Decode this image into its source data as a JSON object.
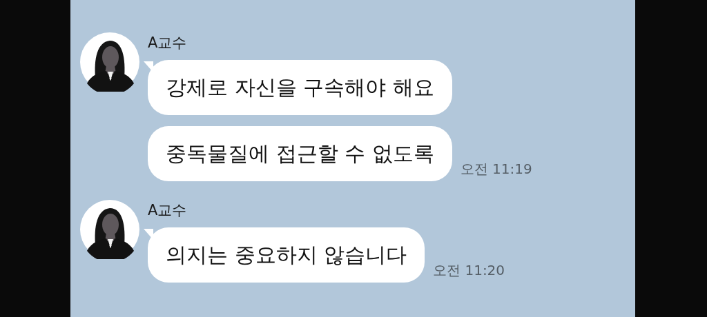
{
  "chat": {
    "message_groups": [
      {
        "sender": "A교수",
        "messages": [
          {
            "text": "강제로 자신을 구속해야 해요"
          },
          {
            "text": "중독물질에 접근할 수 없도록"
          }
        ],
        "time": "오전 11:19"
      },
      {
        "sender": "A교수",
        "messages": [
          {
            "text": "의지는 중요하지 않습니다"
          }
        ],
        "time": "오전 11:20"
      }
    ]
  }
}
